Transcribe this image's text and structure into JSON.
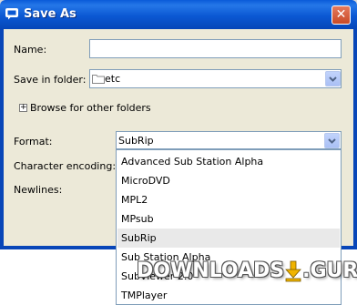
{
  "window": {
    "title": "Save As",
    "close_glyph": "✕"
  },
  "form": {
    "name_label": "Name:",
    "name_value": "",
    "folder_label": "Save in folder:",
    "folder_value": "etc",
    "browse_label": "Browse for other folders",
    "browse_expander": "+",
    "format_label": "Format:",
    "format_value": "SubRip",
    "encoding_label": "Character encoding:",
    "newlines_label": "Newlines:"
  },
  "format_options": [
    "Advanced Sub Station Alpha",
    "MicroDVD",
    "MPL2",
    "MPsub",
    "SubRip",
    "Sub Station Alpha",
    "SubViewer 2.0",
    "TMPlayer"
  ],
  "selected_format_index": 4,
  "watermark": {
    "left": "DOWNLOADS",
    "right": ".GURU"
  },
  "icons": [
    "window-icon",
    "close-icon",
    "folder-icon",
    "chevron-down-icon",
    "expander-plus-icon",
    "download-arrow-icon"
  ],
  "colors": {
    "titlebar": "#0a5ad9",
    "client": "#ece9d8",
    "selected_option": "#e9e9e9",
    "accent_arrow": "#f0b400"
  }
}
